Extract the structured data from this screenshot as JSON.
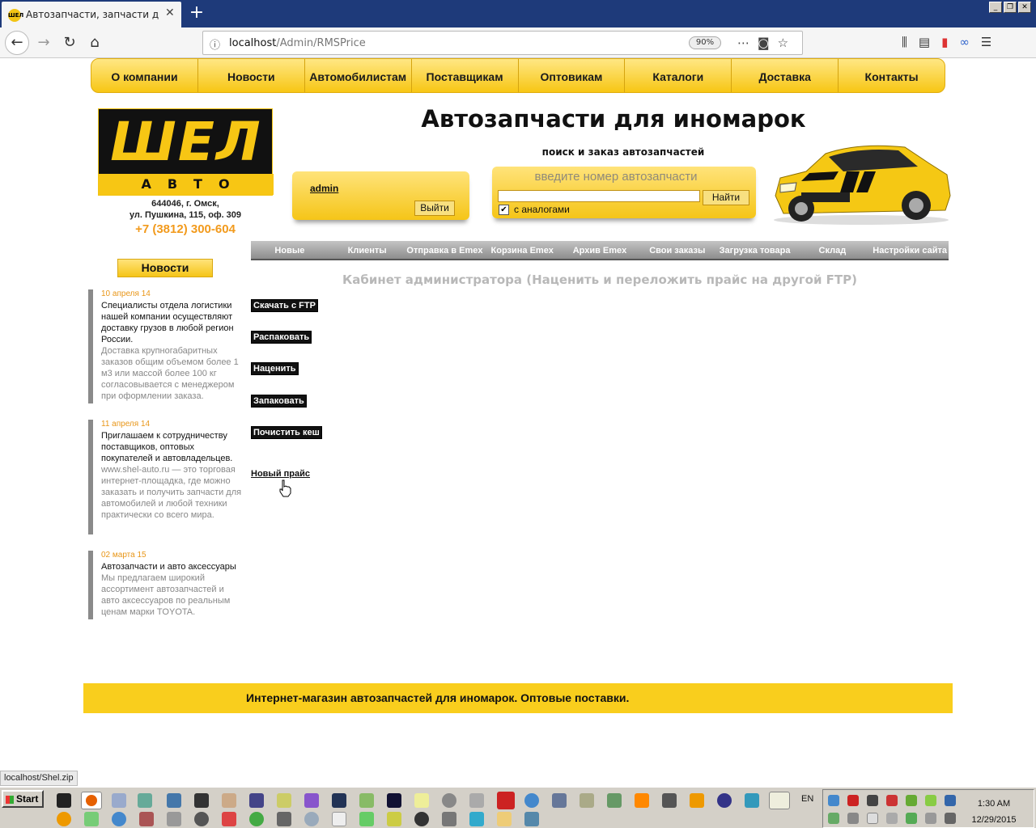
{
  "browser": {
    "tab_title": "Автозапчасти, запчасти для ино",
    "tab_icon_text": "ШЕЛ",
    "url_host": "localhost",
    "url_path": "/Admin/RMSPrice",
    "zoom": "90%",
    "status_url": "localhost/Shel.zip"
  },
  "top_menu": [
    "О компании",
    "Новости",
    "Автомобилистам",
    "Поставщикам",
    "Оптовикам",
    "Каталоги",
    "Доставка",
    "Контакты"
  ],
  "logo": {
    "big": "ШЕЛ",
    "small": "АВТО"
  },
  "address": {
    "line1": "644046, г. Омск,",
    "line2": "ул. Пушкина, 115, оф. 309",
    "phone": "+7 (3812) 300-604"
  },
  "header": {
    "title": "Автозапчасти для иномарок",
    "subtitle": "поиск и заказ автозапчастей"
  },
  "login": {
    "user": "admin",
    "logout": "Выйти"
  },
  "search": {
    "placeholder": "введите номер автозапчасти",
    "button": "Найти",
    "analogs_label": "с аналогами",
    "analogs_checked": true
  },
  "admin_menu": [
    "Новые",
    "Клиенты",
    "Отправка в Emex",
    "Корзина Emex",
    "Архив Emex",
    "Свои заказы",
    "Загрузка товара",
    "Склад",
    "Настройки сайта"
  ],
  "cabinet_title": "Кабинет администратора (Наценить и переложить прайс на другой FTP)",
  "actions": [
    "Скачать с FTP",
    "Распаковать",
    "Наценить",
    "Запаковать",
    "Почистить кеш"
  ],
  "new_price_link": "Новый прайс",
  "news_heading": "Новости",
  "news": [
    {
      "date": "10 апреля 14",
      "head": "Специалисты отдела логистики нашей компании осуществляют доставку грузов в любой регион России.",
      "body": "Доставка крупногабаритных заказов общим объемом более 1 м3 или массой более 100 кг согласовывается с менеджером при оформлении заказа."
    },
    {
      "date": "11 апреля 14",
      "head": "Приглашаем к сотрудничеству поставщиков, оптовых покупателей и автовладельцев.",
      "body": "www.shel-auto.ru — это торговая интернет-площадка, где можно заказать и получить запчасти для автомобилей и любой техники практически со всего мира."
    },
    {
      "date": "02 марта 15",
      "head": "Автозапчасти и авто аксессуары",
      "body": "Мы предлагаем широкий ассортимент автозапчастей и авто аксессуаров по реальным ценам марки TOYOTA."
    }
  ],
  "footer": "Интернет-магазин автозапчастей для иномарок. Оптовые поставки.",
  "taskbar": {
    "start": "Start",
    "lang": "EN",
    "time": "1:30 AM",
    "date": "12/29/2015"
  }
}
